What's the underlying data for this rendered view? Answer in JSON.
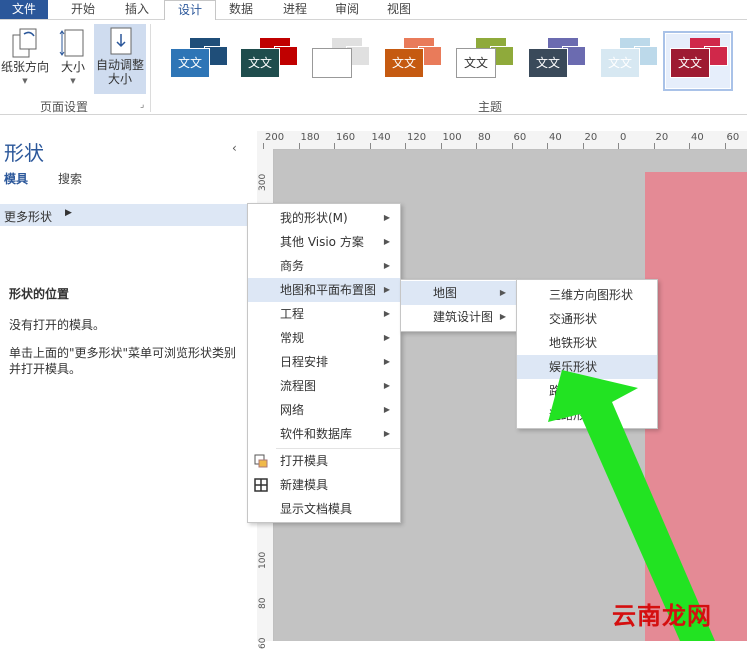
{
  "tabs": [
    "文件",
    "开始",
    "插入",
    "设计",
    "数据",
    "进程",
    "审阅",
    "视图"
  ],
  "ribbon": {
    "paper_orientation": "纸张方向",
    "size": "大小",
    "auto_resize_line1": "自动调整",
    "auto_resize_line2": "大小",
    "page_setup_label": "页面设置",
    "themes_label": "主题",
    "theme_text": "文文",
    "themes": [
      {
        "back": "#1f4e79",
        "front": "#2e75b6",
        "text": "#ffffff"
      },
      {
        "back": "#c00000",
        "front": "#1f4d4d",
        "text": "#ffffff"
      },
      {
        "back": "#e0e0e0",
        "front": "#ffffff",
        "text": "#ffffff"
      },
      {
        "back": "#e97b5a",
        "front": "#c55a11",
        "text": "#ffffff"
      },
      {
        "back": "#8faa3b",
        "front": "#ffffff",
        "text": "#333333"
      },
      {
        "back": "#6b6bb0",
        "front": "#3a4a5a",
        "text": "#ffffff"
      },
      {
        "back": "#bcd9ea",
        "front": "#d7e8f2",
        "text": "#ffffff"
      },
      {
        "back": "#d0284a",
        "front": "#9e1b32",
        "text": "#ffffff"
      }
    ]
  },
  "shapes_pane": {
    "title": "形状",
    "tab_stencils": "模具",
    "tab_search": "搜索",
    "more_shapes": "更多形状",
    "location_title": "形状的位置",
    "no_stencils": "没有打开的模具。",
    "hint": "单击上面的\"更多形状\"菜单可浏览形状类别并打开模具。"
  },
  "ruler": {
    "h_labels": [
      "200",
      "180",
      "160",
      "140",
      "120",
      "100",
      "80",
      "60",
      "40",
      "20",
      "0",
      "20",
      "40",
      "60",
      "80"
    ],
    "v_labels": [
      "300",
      "100",
      "80",
      "60"
    ]
  },
  "menu1": {
    "items": [
      "我的形状(M)",
      "其他 Visio 方案",
      "商务",
      "地图和平面布置图",
      "工程",
      "常规",
      "日程安排",
      "流程图",
      "网络",
      "软件和数据库"
    ],
    "actions": [
      "打开模具",
      "新建模具",
      "显示文档模具"
    ]
  },
  "menu2": {
    "items": [
      "地图",
      "建筑设计图"
    ]
  },
  "menu3": {
    "items": [
      "三维方向图形状",
      "交通形状",
      "地铁形状",
      "娱乐形状",
      "路标形状",
      "道路形状"
    ]
  },
  "watermark": "云南龙网",
  "colors": {
    "accent": "#2b579a",
    "highlight": "#dde7f5",
    "page": "#e48a95",
    "arrow": "#22e322"
  }
}
